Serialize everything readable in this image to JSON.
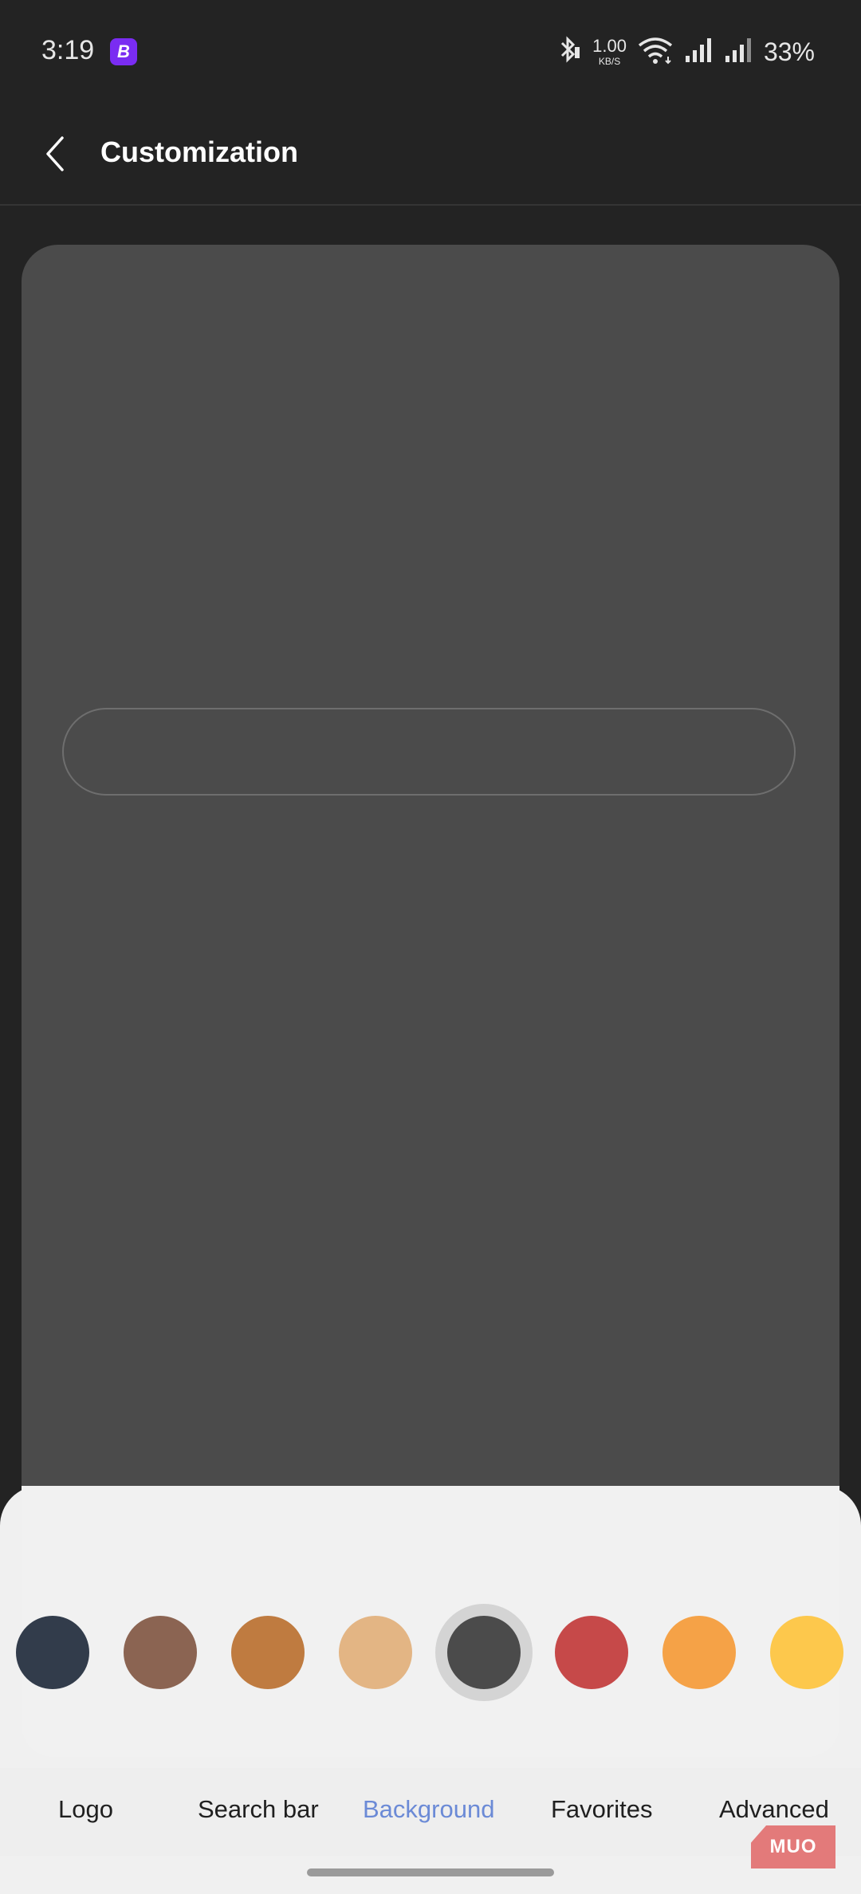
{
  "status_bar": {
    "time": "3:19",
    "app_badge_letter": "B",
    "net_speed_value": "1.00",
    "net_speed_unit": "KB/S",
    "battery": "33%",
    "icons": [
      "bluetooth-icon",
      "wifi-icon",
      "signal-icon",
      "signal-icon"
    ]
  },
  "app_bar": {
    "title": "Customization",
    "back_icon": "chevron-left-icon"
  },
  "colors": {
    "accent": "#6b8ad6",
    "background": "#232323",
    "preview": "#4b4b4b",
    "sheet": "#f0f0f0"
  },
  "swatches": [
    {
      "name": "navy",
      "color": "#323c4b",
      "selected": false
    },
    {
      "name": "brown",
      "color": "#8b6452",
      "selected": false
    },
    {
      "name": "copper",
      "color": "#bf7b40",
      "selected": false
    },
    {
      "name": "tan",
      "color": "#e3b584",
      "selected": false
    },
    {
      "name": "dark-gray",
      "color": "#4b4b4b",
      "selected": true
    },
    {
      "name": "red",
      "color": "#c64949",
      "selected": false
    },
    {
      "name": "orange",
      "color": "#f5a247",
      "selected": false
    },
    {
      "name": "yellow",
      "color": "#fdc84c",
      "selected": false
    }
  ],
  "tabs": [
    {
      "label": "Logo",
      "active": false
    },
    {
      "label": "Search bar",
      "active": false
    },
    {
      "label": "Background",
      "active": true
    },
    {
      "label": "Favorites",
      "active": false
    },
    {
      "label": "Advanced",
      "active": false
    }
  ],
  "watermark": "MUO"
}
